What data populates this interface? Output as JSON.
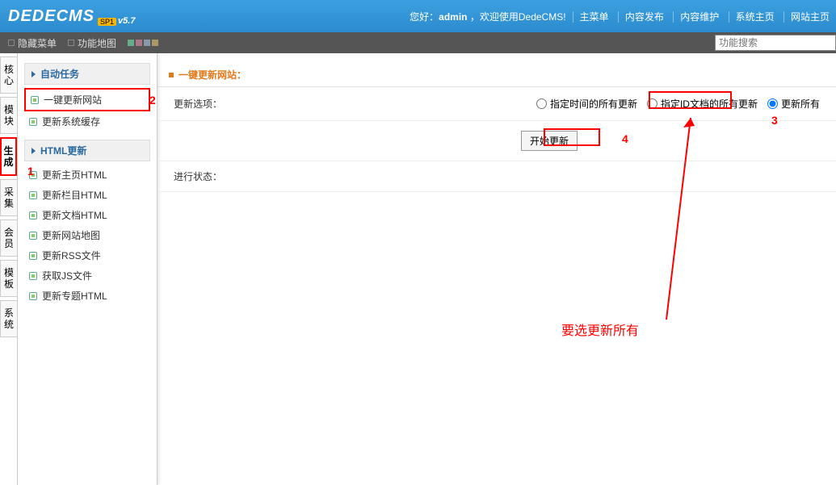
{
  "logo": {
    "text": "DEDECMS",
    "badge": "SP1",
    "version": "v5.7"
  },
  "welcome": {
    "prefix": "您好：",
    "user": "admin",
    "suffix": " ，欢迎使用DedeCMS!"
  },
  "topnav": [
    "主菜单",
    "内容发布",
    "内容维护",
    "系统主页",
    "网站主页"
  ],
  "subbar": {
    "hide": "隐藏菜单",
    "map": "功能地图"
  },
  "search": {
    "placeholder": "功能搜索"
  },
  "vtabs": [
    "核心",
    "模块",
    "生成",
    "采集",
    "会员",
    "模板",
    "系统"
  ],
  "vtab_active": 2,
  "sidebar": {
    "group1": {
      "title": "自动任务",
      "items": [
        "一键更新网站",
        "更新系统缓存"
      ]
    },
    "group2": {
      "title": "HTML更新",
      "items": [
        "更新主页HTML",
        "更新栏目HTML",
        "更新文档HTML",
        "更新网站地图",
        "更新RSS文件",
        "获取JS文件",
        "更新专题HTML"
      ]
    }
  },
  "panel": {
    "title": "一键更新网站：",
    "option_label": "更新选项：",
    "radios": [
      "指定时间的所有更新",
      "指定ID文档的所有更新",
      "更新所有"
    ],
    "radio_selected": 2,
    "start_btn": "开始更新",
    "status_label": "进行状态："
  },
  "annotations": {
    "n1": "1",
    "n2": "2",
    "n3": "3",
    "n4": "4",
    "note": "要选更新所有"
  }
}
